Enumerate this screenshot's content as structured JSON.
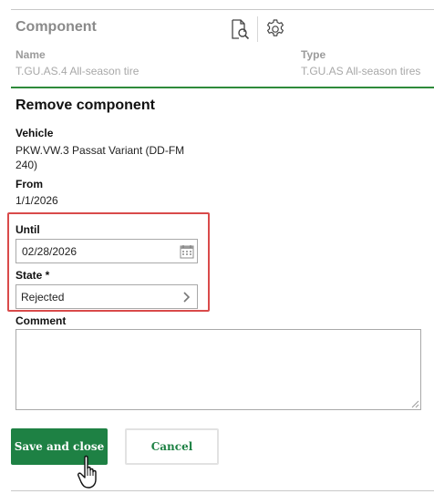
{
  "header": {
    "title": "Component",
    "icons": [
      "document-search-icon",
      "gear-icon"
    ]
  },
  "meta": {
    "name_label": "Name",
    "name_value": "T.GU.AS.4 All-season tire",
    "type_label": "Type",
    "type_value": "T.GU.AS All-season tires"
  },
  "form": {
    "title": "Remove component",
    "vehicle_label": "Vehicle",
    "vehicle_value_line1": "PKW.VW.3 Passat Variant (DD-FM",
    "vehicle_value_line2": "240)",
    "from_label": "From",
    "from_value": "1/1/2026",
    "until_label": "Until",
    "until_value": "02/28/2026",
    "state_label": "State *",
    "state_value": "Rejected",
    "comment_label": "Comment",
    "comment_value": ""
  },
  "actions": {
    "save_label": "Save and close",
    "cancel_label": "Cancel"
  },
  "colors": {
    "accent": "#1e8144",
    "divider": "#2e8b3a",
    "highlight": "#d94a4a"
  }
}
